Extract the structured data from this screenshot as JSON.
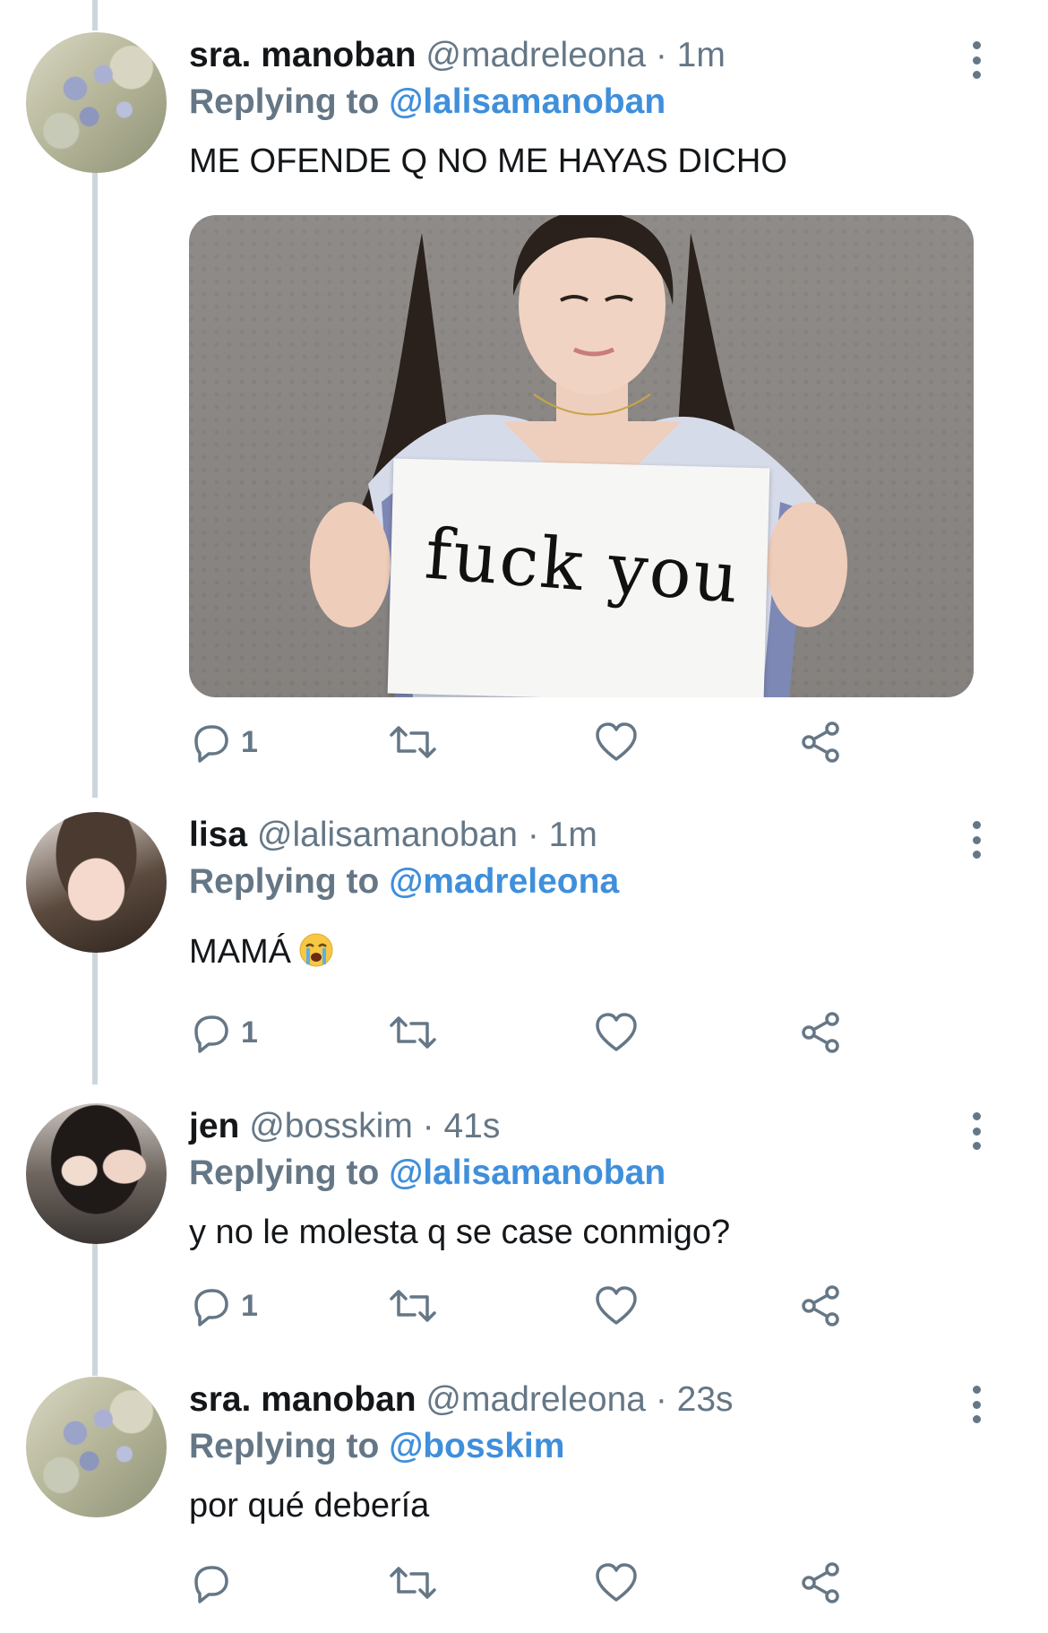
{
  "colors": {
    "link_blue": "#3f8fdb",
    "secondary_gray": "#657786",
    "thread_line": "#ccd6dd"
  },
  "icons": {
    "reply": "reply-icon",
    "retweet": "retweet-icon",
    "like": "heart-icon",
    "share": "share-icon",
    "more": "more-options-icon",
    "emoji": "loudly-crying-face-emoji"
  },
  "tweets": [
    {
      "name": "sra. manoban",
      "handle_meta": "@madreleona · 1m",
      "reply_label": "Replying to",
      "reply_handle": "@lalisamanoban",
      "text": "ME OFENDE Q NO ME HAYAS DICHO",
      "media_text": "fuck you",
      "reply_count": "1"
    },
    {
      "name": "lisa",
      "handle_meta": "@lalisamanoban · 1m",
      "reply_label": "Replying to",
      "reply_handle": "@madreleona",
      "text": "MAMÁ",
      "reply_count": "1"
    },
    {
      "name": "jen",
      "handle_meta": "@bosskim · 41s",
      "reply_label": "Replying to",
      "reply_handle": "@lalisamanoban",
      "text": "y no le molesta q se case conmigo?",
      "reply_count": "1"
    },
    {
      "name": "sra. manoban",
      "handle_meta": "@madreleona · 23s",
      "reply_label": "Replying to",
      "reply_handle": "@bosskim",
      "text": "por qué debería",
      "reply_count": ""
    }
  ]
}
